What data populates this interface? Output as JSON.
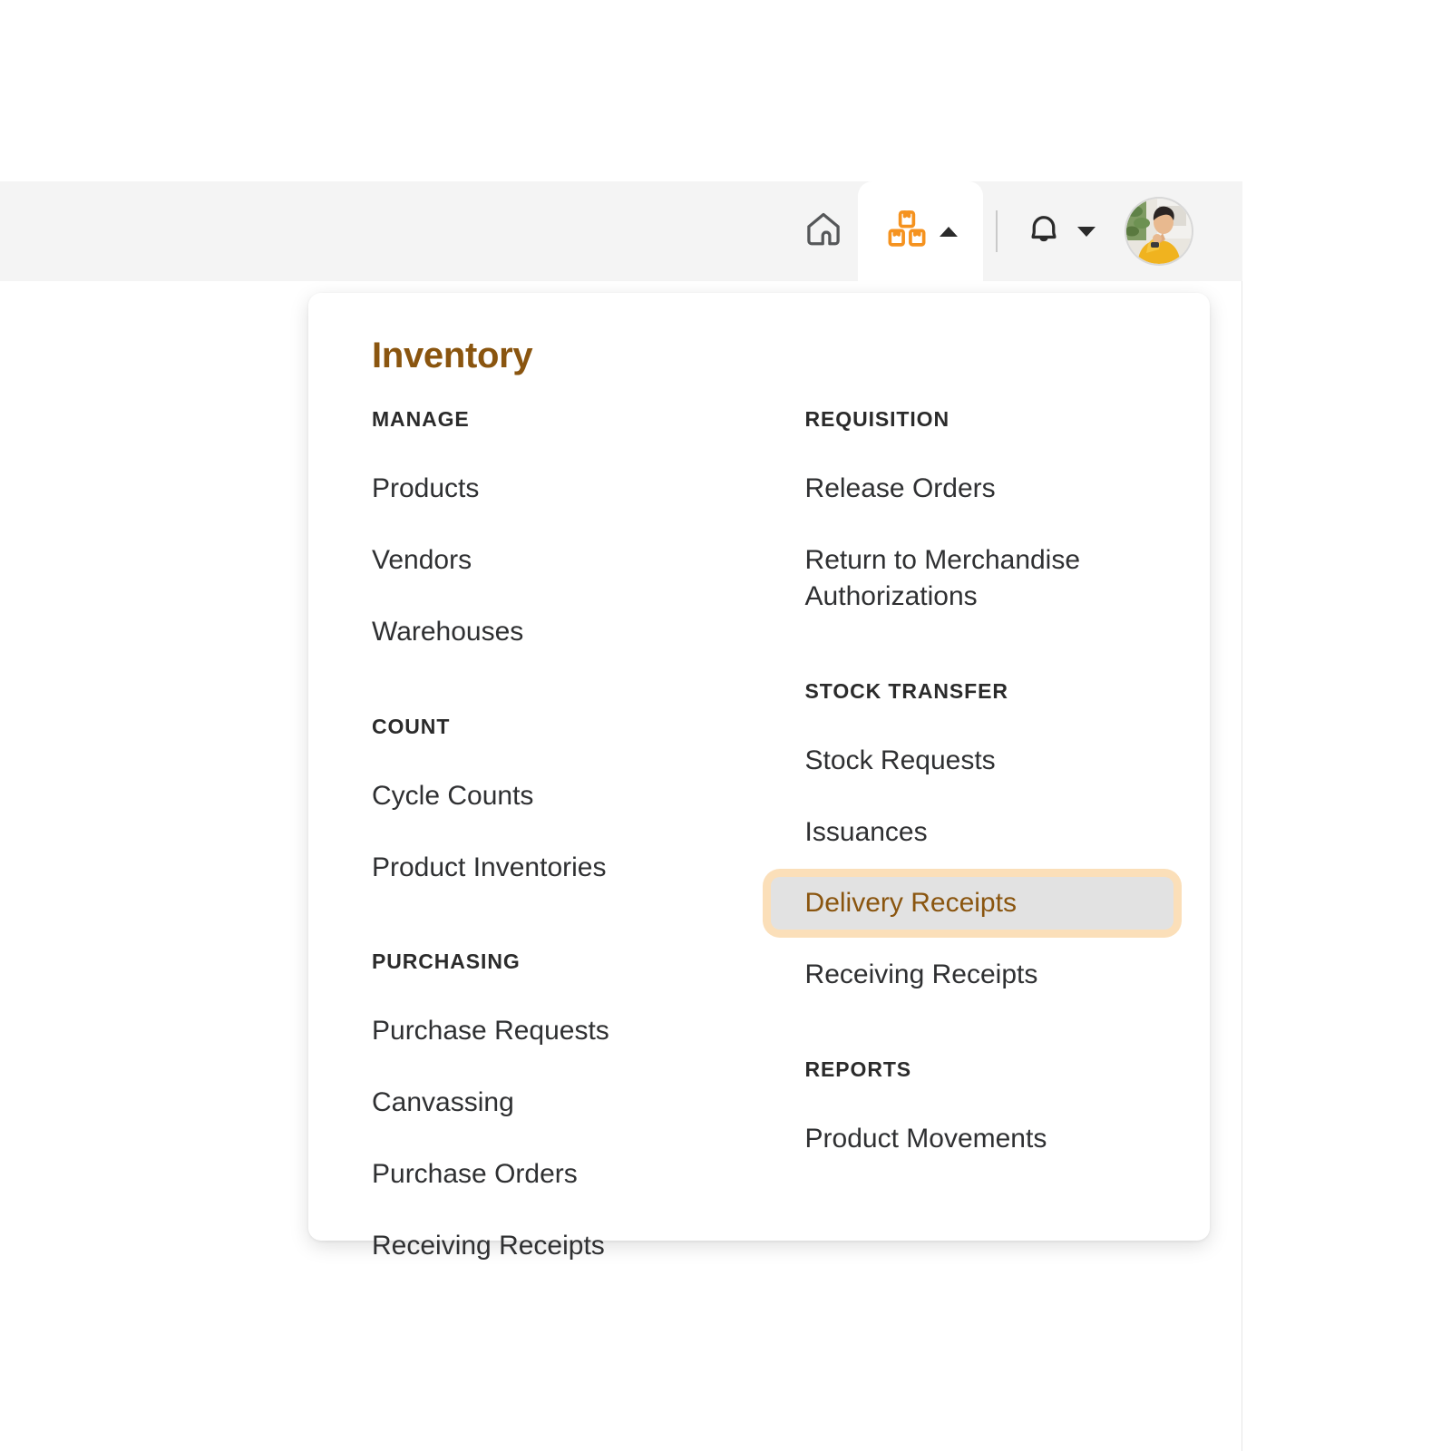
{
  "header": {
    "home_icon": "home-icon",
    "inventory_tab": {
      "icon": "boxes-icon",
      "caret": "caret-up-icon",
      "label": "Inventory"
    },
    "notifications": {
      "icon": "bell-icon",
      "caret": "caret-down-icon"
    },
    "avatar": "user-avatar",
    "accent_color": "#f5921e"
  },
  "menu": {
    "title": "Inventory",
    "title_color": "#8a550f",
    "selected_item": "Delivery Receipts",
    "selected_bg": "#e2e2e2",
    "selected_ring": "#fbdfb9",
    "left_sections": [
      {
        "heading": "MANAGE",
        "items": [
          "Products",
          "Vendors",
          "Warehouses"
        ]
      },
      {
        "heading": "COUNT",
        "items": [
          "Cycle Counts",
          "Product Inventories"
        ]
      },
      {
        "heading": "PURCHASING",
        "items": [
          "Purchase Requests",
          "Canvassing",
          "Purchase Orders",
          "Receiving Receipts"
        ]
      }
    ],
    "right_sections": [
      {
        "heading": "REQUISITION",
        "items": [
          "Release Orders",
          "Return to Merchandise Authorizations"
        ]
      },
      {
        "heading": "STOCK TRANSFER",
        "items": [
          "Stock Requests",
          "Issuances",
          "Delivery Receipts",
          "Receiving Receipts"
        ]
      },
      {
        "heading": "REPORTS",
        "items": [
          "Product Movements"
        ]
      }
    ]
  }
}
